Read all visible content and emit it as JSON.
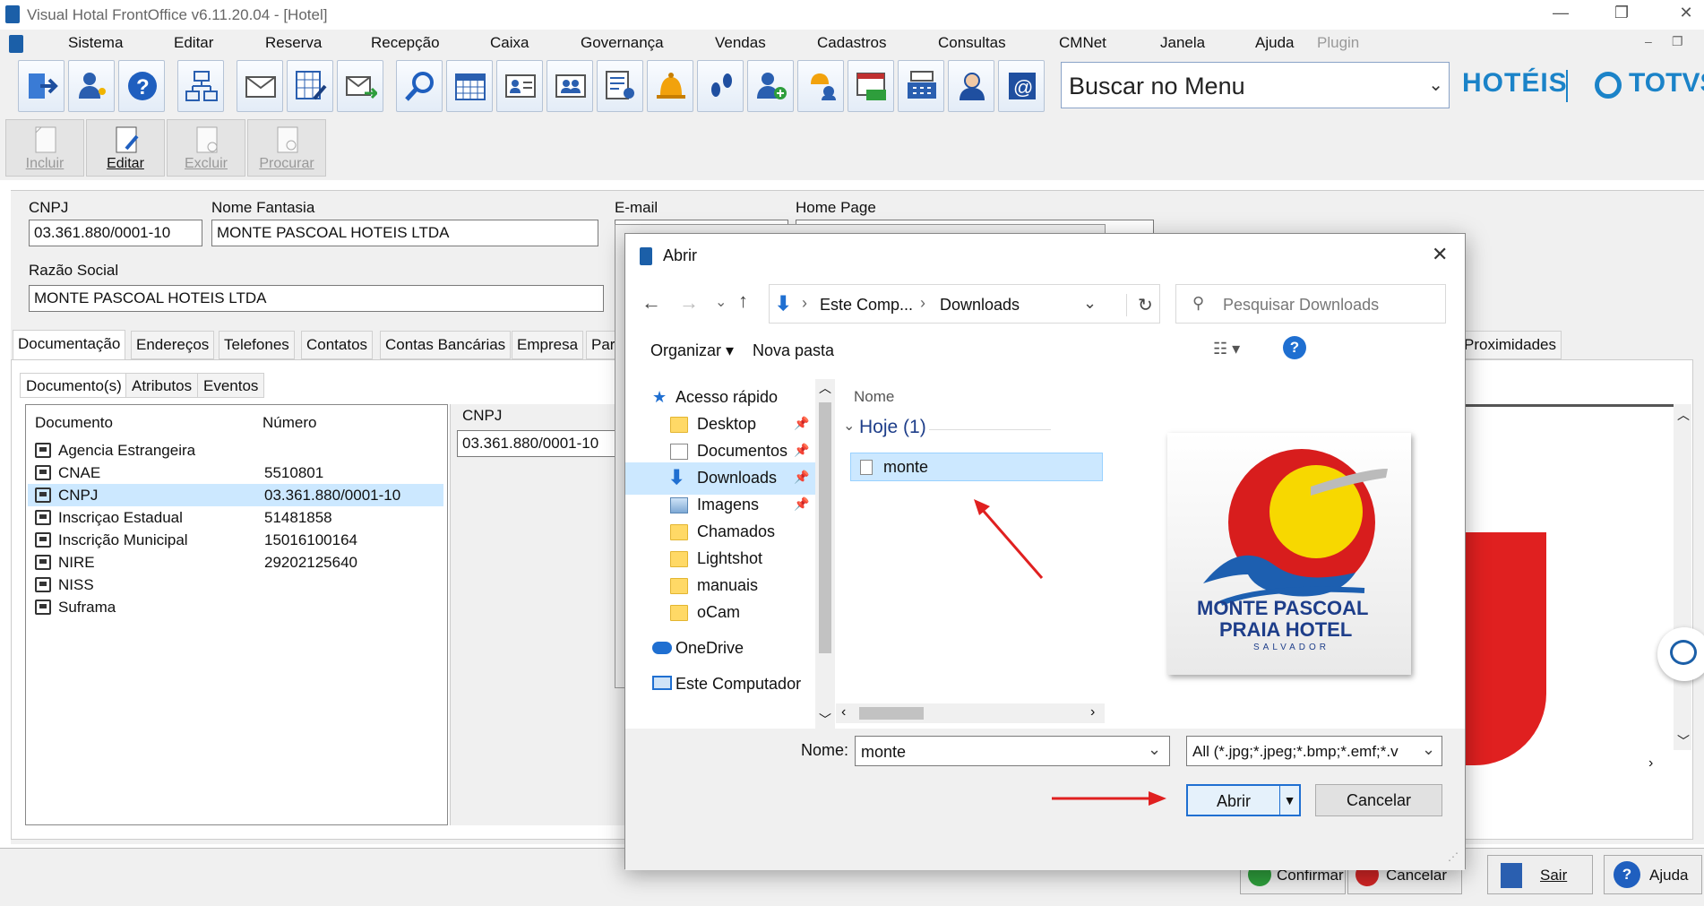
{
  "app": {
    "title": "Visual Hotal FrontOffice v6.11.20.04 - [Hotel]"
  },
  "menu": [
    "Sistema",
    "Editar",
    "Reserva",
    "Recepção",
    "Caixa",
    "Governança",
    "Vendas",
    "Cadastros",
    "Consultas",
    "CMNet",
    "Janela",
    "Ajuda",
    "Plugin"
  ],
  "toolbar": {
    "search_label": "Buscar no Menu",
    "brand_hoteis": "HOTÉIS",
    "brand_totvs": "TOTVS",
    "actions": [
      "Incluir",
      "Editar",
      "Excluir",
      "Procurar"
    ]
  },
  "form": {
    "cnpj_label": "CNPJ",
    "cnpj_value": "03.361.880/0001-10",
    "fantasia_label": "Nome Fantasia",
    "fantasia_value": "MONTE PASCOAL HOTEIS LTDA",
    "email_label": "E-mail",
    "homepage_label": "Home Page",
    "razao_label": "Razão Social",
    "razao_value": "MONTE PASCOAL HOTEIS LTDA",
    "tabs": [
      "Documentação",
      "Endereços",
      "Telefones",
      "Contatos",
      "Contas Bancárias",
      "Empresa",
      "Par"
    ],
    "tab_right": "Proximidades",
    "subtabs": [
      "Documento(s)",
      "Atributos",
      "Eventos"
    ],
    "doc_header": {
      "col1": "Documento",
      "col2": "Número"
    },
    "documents": [
      {
        "name": "Agencia Estrangeira",
        "number": ""
      },
      {
        "name": "CNAE",
        "number": "5510801"
      },
      {
        "name": "CNPJ",
        "number": "03.361.880/0001-10"
      },
      {
        "name": "Inscriçao Estadual",
        "number": "51481858"
      },
      {
        "name": "Inscrição Municipal",
        "number": "15016100164"
      },
      {
        "name": "NIRE",
        "number": "29202125640"
      },
      {
        "name": "NISS",
        "number": ""
      },
      {
        "name": "Suframa",
        "number": ""
      }
    ],
    "detail_label": "CNPJ",
    "detail_value": "03.361.880/0001-10"
  },
  "bottom_buttons": {
    "confirmar": "Confirmar",
    "cancelar": "Cancelar",
    "sair": "Sair",
    "ajuda": "Ajuda"
  },
  "dialog": {
    "title": "Abrir",
    "path": [
      "Este Comp...",
      "Downloads"
    ],
    "search_placeholder": "Pesquisar Downloads",
    "organizar": "Organizar",
    "nova_pasta": "Nova pasta",
    "nav_items": [
      {
        "label": "Acesso rápido",
        "kind": "star"
      },
      {
        "label": "Desktop",
        "kind": "folder",
        "pinned": true
      },
      {
        "label": "Documentos",
        "kind": "doc",
        "pinned": true
      },
      {
        "label": "Downloads",
        "kind": "download",
        "pinned": true
      },
      {
        "label": "Imagens",
        "kind": "image",
        "pinned": true
      },
      {
        "label": "Chamados",
        "kind": "folder"
      },
      {
        "label": "Lightshot",
        "kind": "folder"
      },
      {
        "label": "manuais",
        "kind": "folder"
      },
      {
        "label": "oCam",
        "kind": "folder"
      },
      {
        "label": "OneDrive",
        "kind": "cloud"
      },
      {
        "label": "Este Computador",
        "kind": "pc"
      }
    ],
    "column_name": "Nome",
    "group_label": "Hoje (1)",
    "file_name": "monte",
    "preview_logo": {
      "line1": "MONTE PASCOAL",
      "line2": "PRAIA HOTEL",
      "line3": "SALVADOR"
    },
    "name_label": "Nome:",
    "name_value": "monte",
    "filter_value": "All (*.jpg;*.jpeg;*.bmp;*.emf;*.v",
    "open_button": "Abrir",
    "cancel_button": "Cancelar"
  },
  "colors": {
    "accent": "#1b83c8",
    "arrow": "#e02020",
    "selection": "#cce8ff"
  }
}
